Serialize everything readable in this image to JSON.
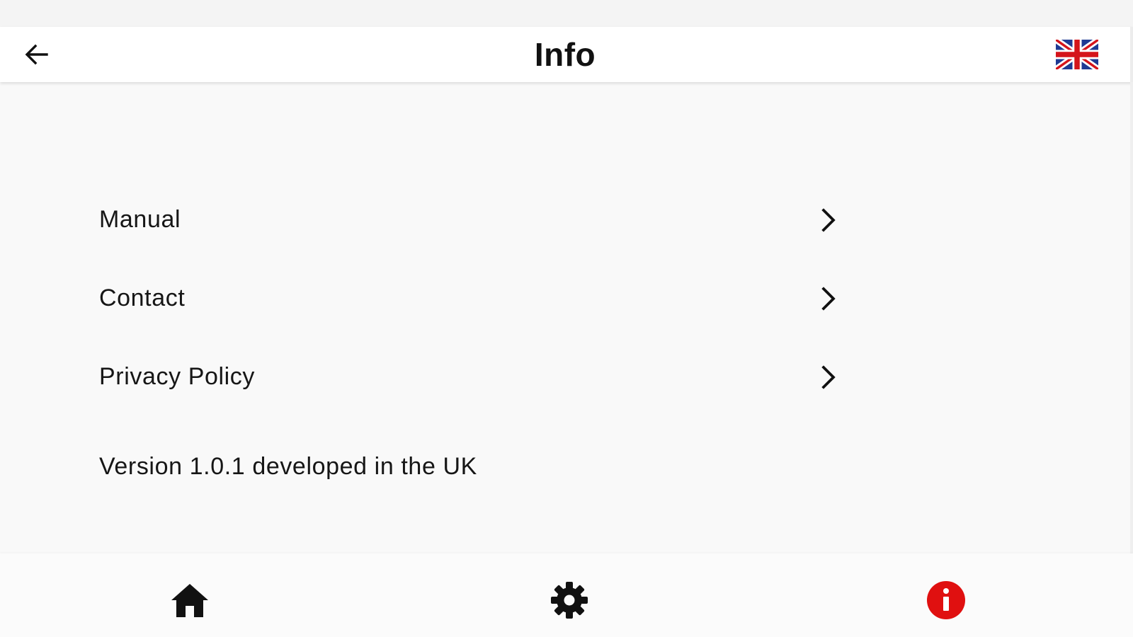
{
  "app_bar": {
    "title": "Info",
    "back_icon": "arrow-back-icon",
    "language_icon": "uk-flag-icon"
  },
  "menu": {
    "items": [
      {
        "label": "Manual",
        "icon": "chevron-right-icon"
      },
      {
        "label": "Contact",
        "icon": "chevron-right-icon"
      },
      {
        "label": "Privacy Policy",
        "icon": "chevron-right-icon"
      }
    ]
  },
  "footer_text": "Version 1.0.1 developed in the UK",
  "bottom_nav": {
    "items": [
      {
        "icon": "home-icon",
        "active": false
      },
      {
        "icon": "gear-icon",
        "active": false
      },
      {
        "icon": "info-icon",
        "active": true
      }
    ]
  },
  "colors": {
    "background": "#f9f9f9",
    "app_bar": "#ffffff",
    "text": "#111111",
    "active_nav": "#e01010",
    "flag_blue": "#1f3a93",
    "flag_red": "#d4141b"
  }
}
